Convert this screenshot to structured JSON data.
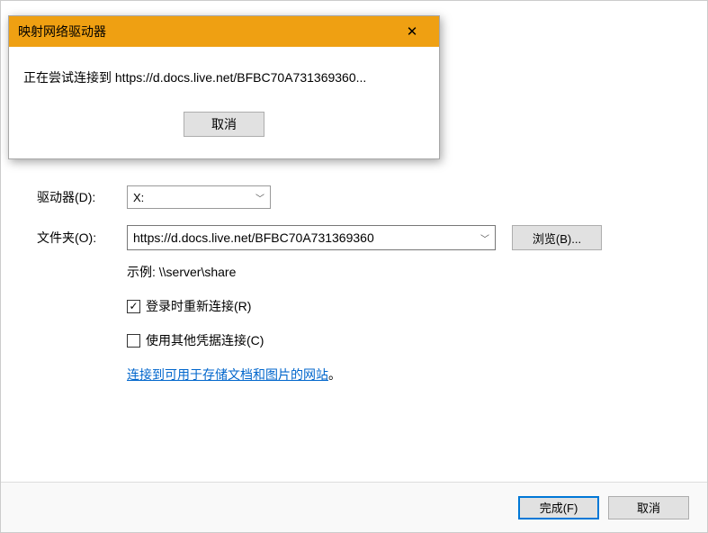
{
  "wizard": {
    "drive_label": "驱动器(D):",
    "drive_value": "X:",
    "folder_label": "文件夹(O):",
    "folder_value": "https://d.docs.live.net/BFBC70A731369360",
    "browse_label": "浏览(B)...",
    "example_text": "示例: \\\\server\\share",
    "reconnect_label": "登录时重新连接(R)",
    "reconnect_checked": true,
    "credentials_label": "使用其他凭据连接(C)",
    "credentials_checked": false,
    "link_text": "连接到可用于存储文档和图片的网站",
    "link_period": "。",
    "finish_label": "完成(F)",
    "cancel_label": "取消"
  },
  "progress": {
    "title": "映射网络驱动器",
    "message": "正在尝试连接到 https://d.docs.live.net/BFBC70A731369360...",
    "cancel_label": "取消",
    "close_glyph": "✕"
  }
}
